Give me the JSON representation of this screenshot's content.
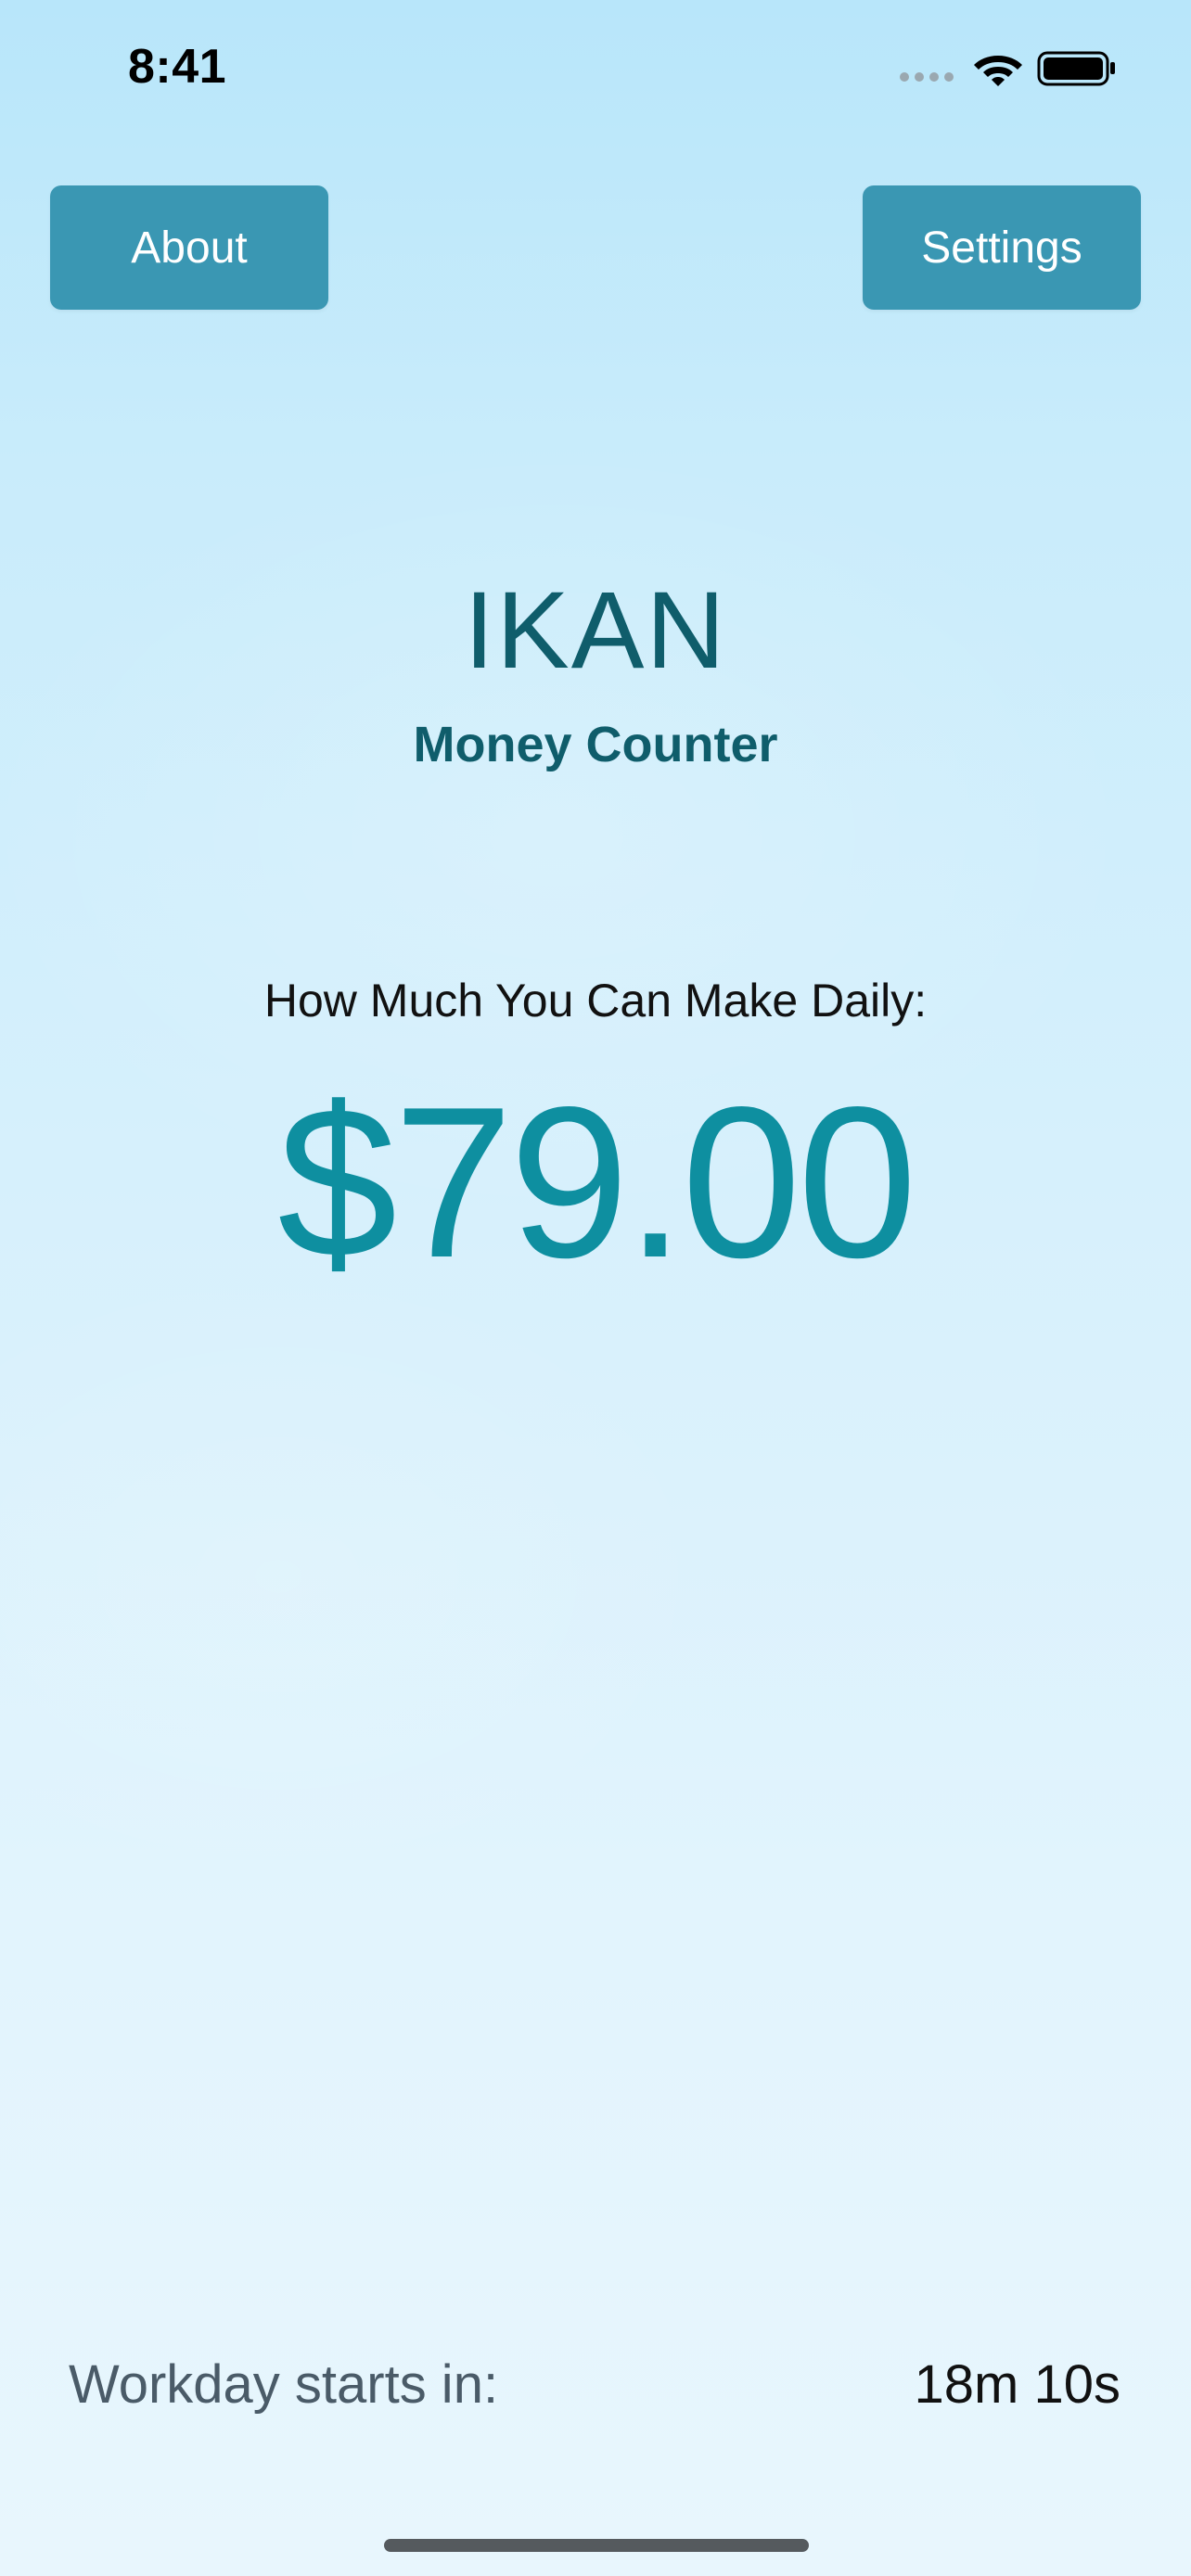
{
  "status_bar": {
    "time": "8:41",
    "icons": [
      "signal-icon",
      "wifi-icon",
      "battery-icon"
    ]
  },
  "header": {
    "about_label": "About",
    "settings_label": "Settings"
  },
  "main": {
    "title": "IKAN",
    "subtitle": "Money Counter",
    "daily_label": "How Much You Can Make Daily:",
    "daily_amount": "$79.00"
  },
  "footer": {
    "workday_label": "Workday starts in:",
    "countdown": "18m 10s"
  },
  "colors": {
    "button_bg": "#3a97b3",
    "title": "#0f5d6b",
    "amount": "#0e8fa0",
    "background_top": "#b8e6fa",
    "background_bottom": "#e8f6fd"
  }
}
